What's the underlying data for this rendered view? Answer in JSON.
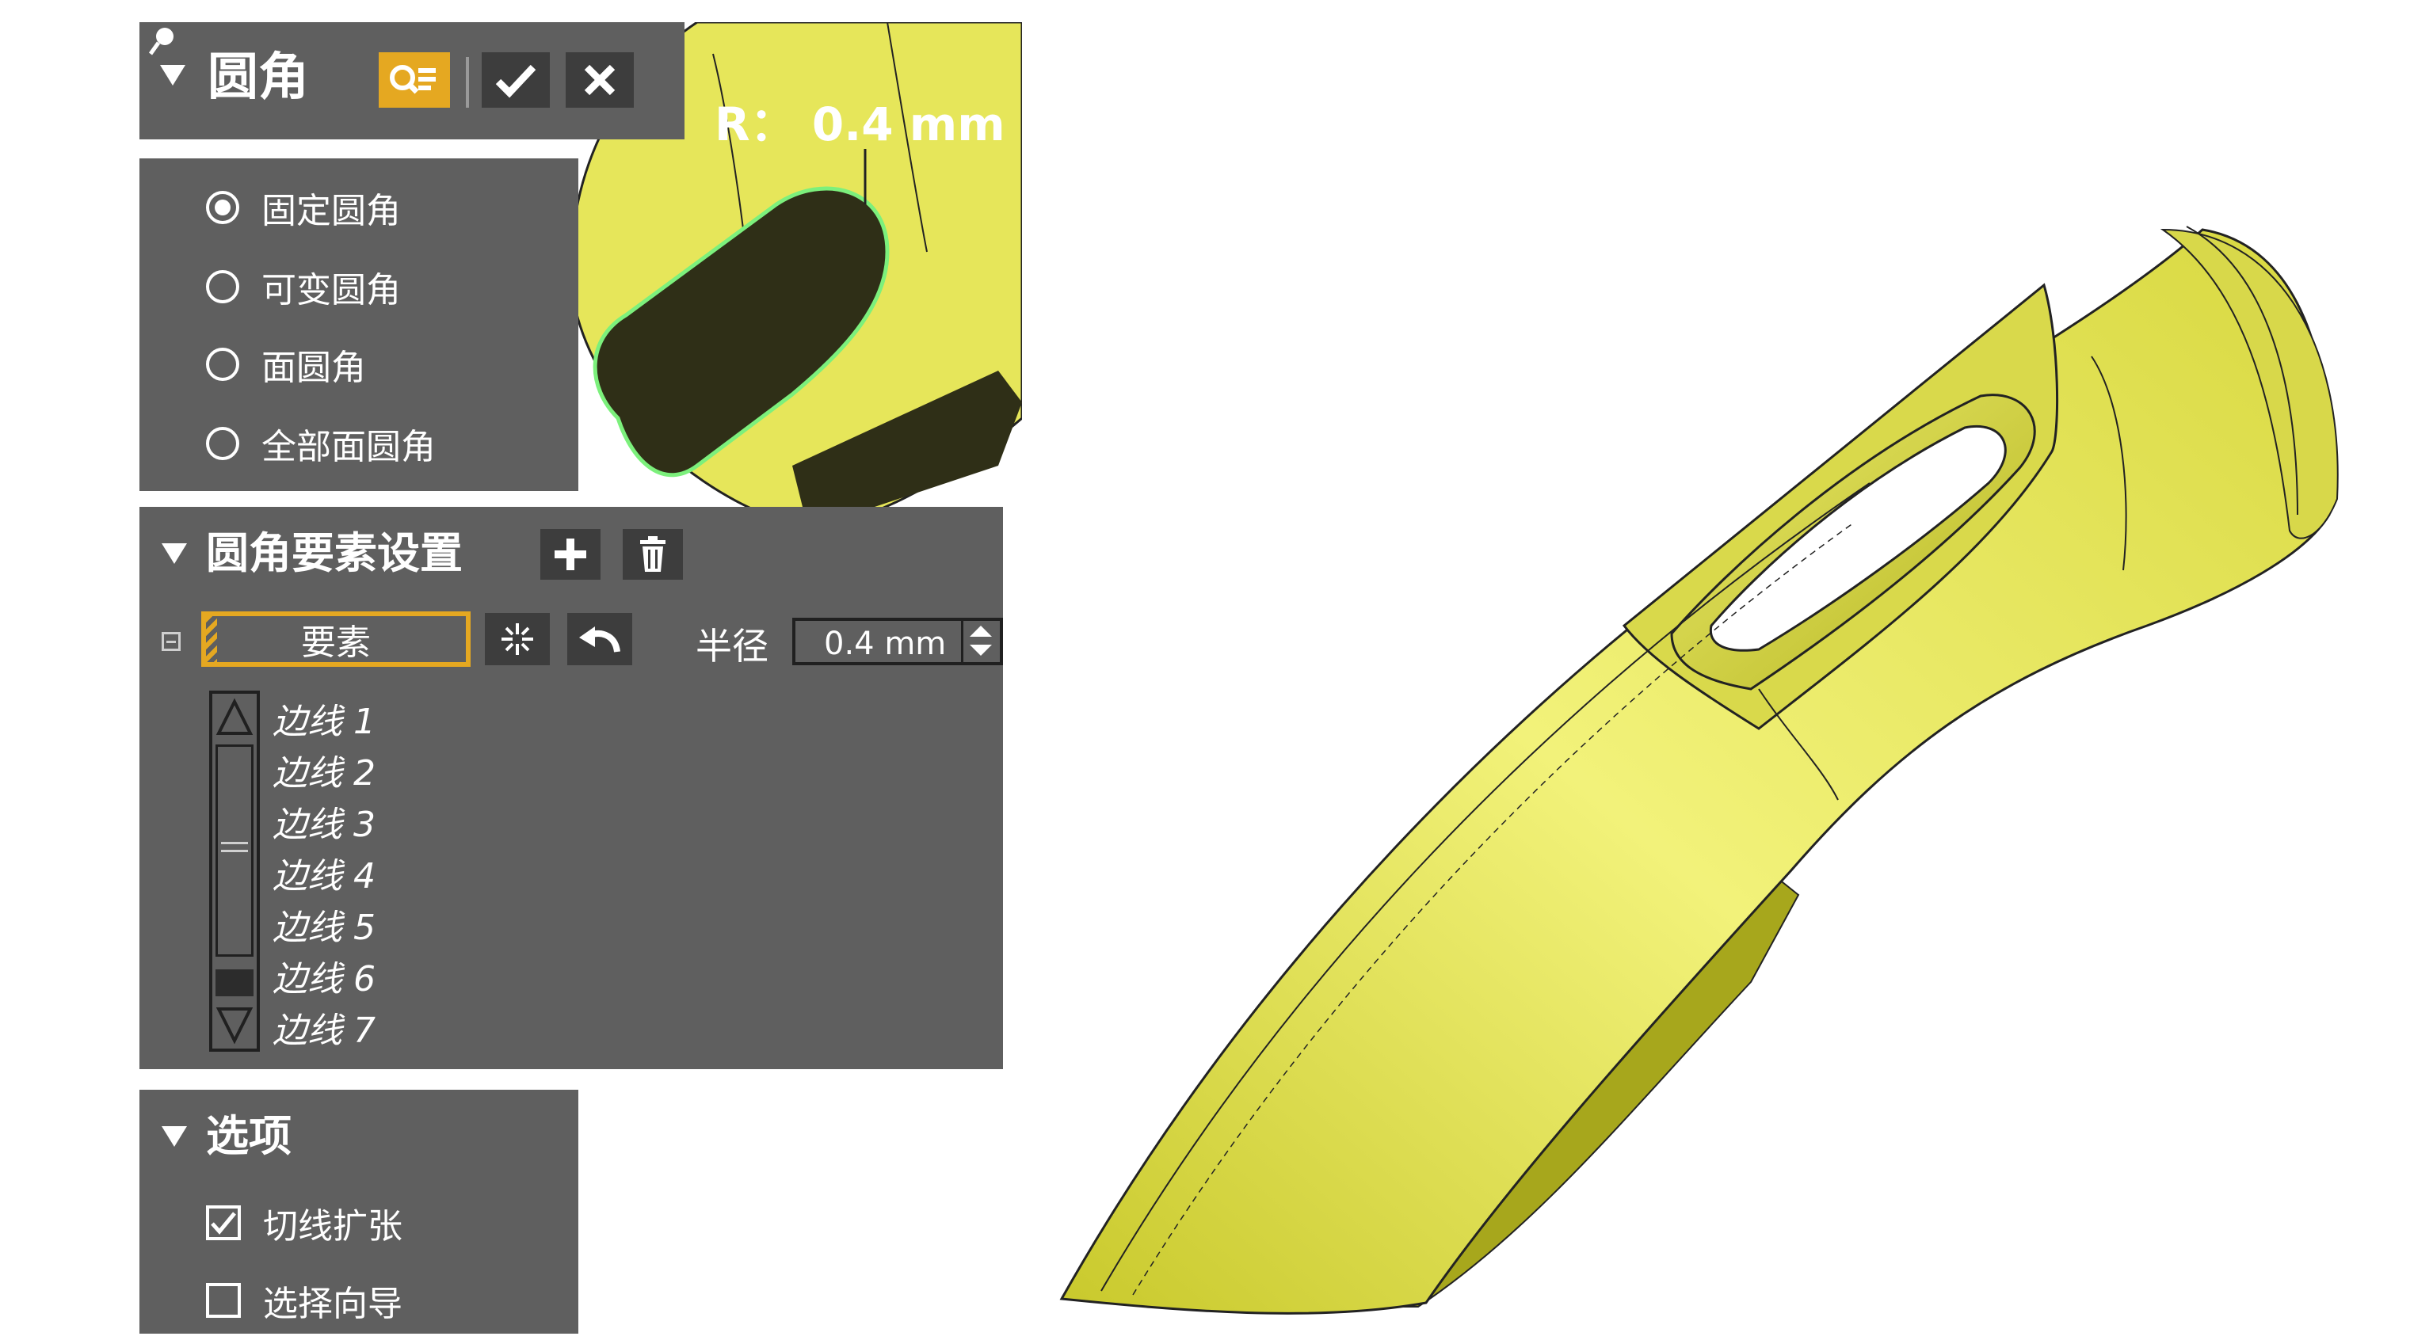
{
  "dialog": {
    "title": "圆角",
    "annotation": "R： 0.4 mm",
    "header_icons": [
      "search-list-icon",
      "check-icon",
      "close-icon"
    ]
  },
  "fillet_types": {
    "options": [
      "固定圆角",
      "可变圆角",
      "面圆角",
      "全部面圆角"
    ],
    "selected": "固定圆角"
  },
  "element_settings": {
    "title": "圆角要素设置",
    "element_button": "要素",
    "radius_label": "半径",
    "radius_value": "0.4 mm",
    "edges": [
      "边线 1",
      "边线 2",
      "边线 3",
      "边线 4",
      "边线 5",
      "边线 6",
      "边线 7"
    ]
  },
  "options": {
    "title": "选项",
    "items": [
      {
        "label": "切线扩张",
        "checked": true
      },
      {
        "label": "选择向导",
        "checked": false
      }
    ]
  },
  "colors": {
    "panel": "#5f5f5f",
    "accent": "#e5a821",
    "model_yellow": "#e6e65a",
    "selection_edge": "#7cf07c"
  }
}
